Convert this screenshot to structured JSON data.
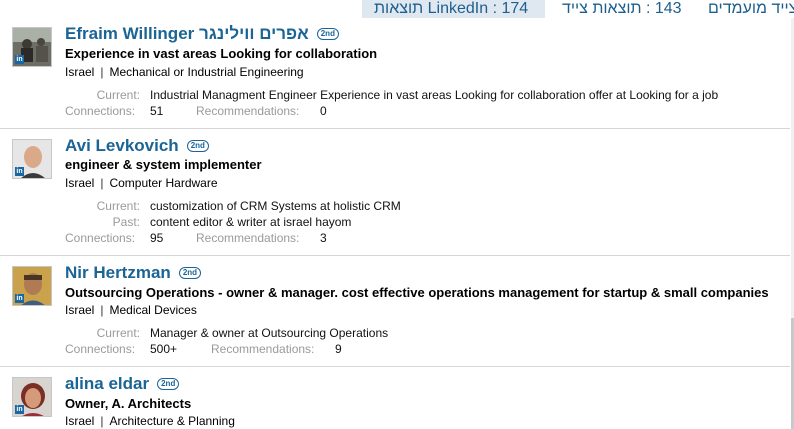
{
  "tabs": {
    "linkedin_label": "LinkedIn : 174 תוצאות",
    "recruiter_label": "143 : תוצאות צייד",
    "featured_label": "צייד מועמדים"
  },
  "results": [
    {
      "name": "Efraim Willinger אפרים ווילינגר",
      "degree": "2nd",
      "headline": "Experience in vast areas Looking for collaboration",
      "location": "Israel",
      "industry": "Mechanical or Industrial Engineering",
      "current_label": "Current:",
      "current": "Industrial Managment Engineer Experience in vast areas Looking for collaboration offer at Looking for a job",
      "connections_label": "Connections:",
      "connections": "51",
      "recommendations_label": "Recommendations:",
      "recommendations": "0"
    },
    {
      "name": "Avi Levkovich",
      "degree": "2nd",
      "headline": "engineer & system implementer",
      "location": "Israel",
      "industry": "Computer Hardware",
      "current_label": "Current:",
      "current": "customization of CRM Systems at holistic CRM",
      "past_label": "Past:",
      "past": "content editor & writer at israel hayom",
      "connections_label": "Connections:",
      "connections": "95",
      "recommendations_label": "Recommendations:",
      "recommendations": "3"
    },
    {
      "name": "Nir Hertzman",
      "degree": "2nd",
      "headline": "Outsourcing Operations - owner & manager. cost effective operations management for startup & small companies",
      "location": "Israel",
      "industry": "Medical Devices",
      "current_label": "Current:",
      "current": "Manager & owner at Outsourcing Operations",
      "connections_label": "Connections:",
      "connections": "500+",
      "recommendations_label": "Recommendations:",
      "recommendations": "9"
    },
    {
      "name": "alina eldar",
      "degree": "2nd",
      "headline": "Owner, A. Architects",
      "location": "Israel",
      "industry": "Architecture & Planning"
    }
  ],
  "badge": {
    "in_label": "in"
  },
  "colors": {
    "link": "#1b6496",
    "tab_bg": "#dfe8f1",
    "muted": "#9a9a9a"
  }
}
